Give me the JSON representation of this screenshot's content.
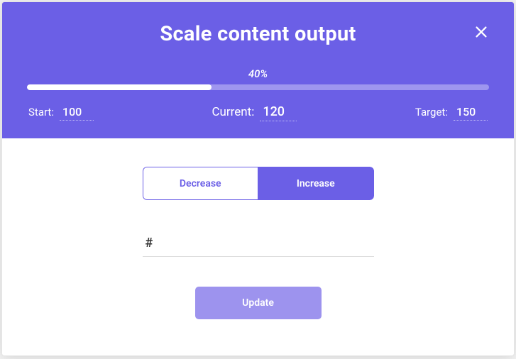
{
  "title": "Scale content output",
  "progress": {
    "percent_label": "40%",
    "fill_width": "40%"
  },
  "values": {
    "start_label": "Start:",
    "start_value": "100",
    "current_label": "Current:",
    "current_value": "120",
    "target_label": "Target:",
    "target_value": "150"
  },
  "segmented": {
    "decrease_label": "Decrease",
    "increase_label": "Increase",
    "active": "increase"
  },
  "amount": {
    "placeholder": "#",
    "value": ""
  },
  "update_label": "Update"
}
